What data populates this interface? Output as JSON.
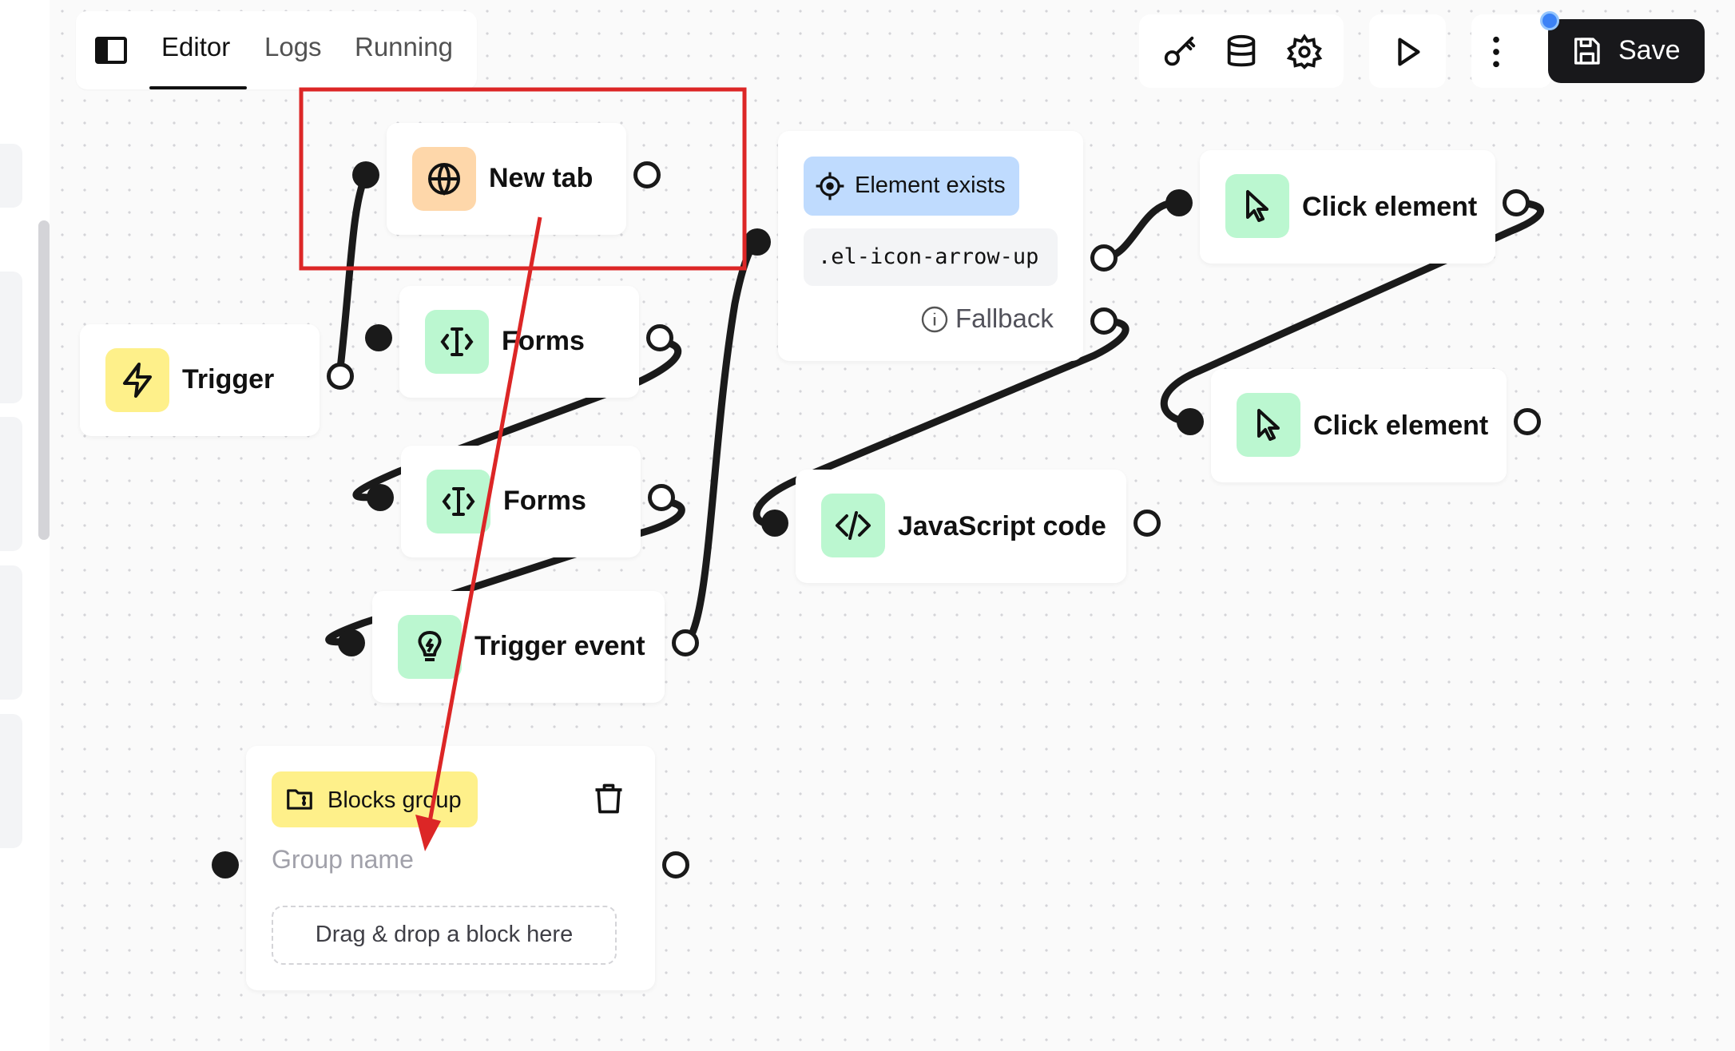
{
  "header": {
    "sidebar_toggle_icon": "panel-left-icon",
    "tabs": [
      {
        "label": "Editor",
        "active": true
      },
      {
        "label": "Logs",
        "active": false
      },
      {
        "label": "Running",
        "active": false
      }
    ],
    "tools": [
      "key-icon",
      "database-icon",
      "gear-icon"
    ],
    "run_icon": "play-icon",
    "more_icon": "more-vertical-icon",
    "save": {
      "label": "Save",
      "icon": "save-icon"
    },
    "status_dot_color": "#3b82f6"
  },
  "nodes": {
    "trigger": {
      "label": "Trigger",
      "icon": "lightning-icon"
    },
    "new_tab": {
      "label": "New tab",
      "icon": "globe-icon"
    },
    "forms_1": {
      "label": "Forms",
      "icon": "text-cursor-icon"
    },
    "forms_2": {
      "label": "Forms",
      "icon": "text-cursor-icon"
    },
    "trigger_event": {
      "label": "Trigger event",
      "icon": "lightbulb-icon"
    },
    "element_exists": {
      "label": "Element exists",
      "icon": "crosshair-icon",
      "selector": ".el-icon-arrow-up",
      "fallback_label": "Fallback",
      "fallback_icon": "info-icon"
    },
    "click_element_1": {
      "label": "Click element",
      "icon": "cursor-icon"
    },
    "click_element_2": {
      "label": "Click element",
      "icon": "cursor-icon"
    },
    "javascript_code": {
      "label": "JavaScript code",
      "icon": "code-icon"
    },
    "blocks_group": {
      "label": "Blocks group",
      "icon": "folder-icon",
      "name_placeholder": "Group name",
      "dropzone_text": "Drag & drop a block here",
      "delete_icon": "trash-icon"
    }
  },
  "colors": {
    "green_icon_bg": "#bbf7d0",
    "yellow_icon_bg": "#fef08a",
    "orange_icon_bg": "#fed7aa",
    "blue_pill_bg": "#bfdbfe",
    "annotation": "#dc2626"
  }
}
